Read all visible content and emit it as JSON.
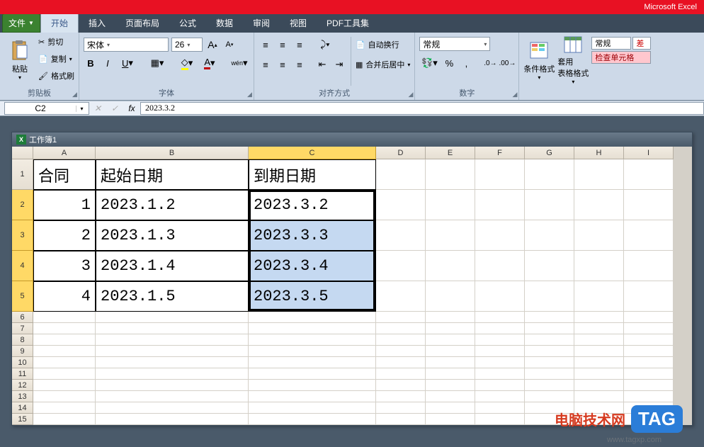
{
  "app_title": "Microsoft Excel",
  "tabs": {
    "file": "文件",
    "home": "开始",
    "insert": "插入",
    "layout": "页面布局",
    "formulas": "公式",
    "data": "数据",
    "review": "审阅",
    "view": "视图",
    "pdf": "PDF工具集"
  },
  "ribbon": {
    "clipboard": {
      "label": "剪贴板",
      "paste": "粘贴",
      "cut": "剪切",
      "copy": "复制",
      "brush": "格式刷"
    },
    "font": {
      "label": "字体",
      "name": "宋体",
      "size": "26"
    },
    "align": {
      "label": "对齐方式",
      "wrap": "自动换行",
      "merge": "合并后居中"
    },
    "number": {
      "label": "数字",
      "format": "常规"
    },
    "cond": {
      "label": "条件格式"
    },
    "tablefmt": {
      "label": "套用\n表格格式"
    },
    "styles": {
      "normal": "常规",
      "bad": "差",
      "check": "检查单元格"
    }
  },
  "namebox": "C2",
  "formula": "2023.3.2",
  "workbook": "工作簿1",
  "cols": [
    "A",
    "B",
    "C",
    "D",
    "E",
    "F",
    "G",
    "H",
    "I"
  ],
  "rows": [
    "1",
    "2",
    "3",
    "4",
    "5",
    "6",
    "7",
    "8",
    "9",
    "10",
    "11",
    "12",
    "13",
    "14",
    "15"
  ],
  "chart_data": {
    "type": "table",
    "headers": [
      "合同",
      "起始日期",
      "到期日期"
    ],
    "data": [
      [
        1,
        "2023.1.2",
        "2023.3.2"
      ],
      [
        2,
        "2023.1.3",
        "2023.3.3"
      ],
      [
        3,
        "2023.1.4",
        "2023.3.4"
      ],
      [
        4,
        "2023.1.5",
        "2023.3.5"
      ]
    ]
  },
  "selection": {
    "active": "C2",
    "range": "C2:C5",
    "blue_cells": [
      "C3",
      "C4",
      "C5"
    ]
  },
  "watermark": {
    "text": "电脑技术网",
    "tag": "TAG",
    "url": "www.tagxp.com"
  }
}
